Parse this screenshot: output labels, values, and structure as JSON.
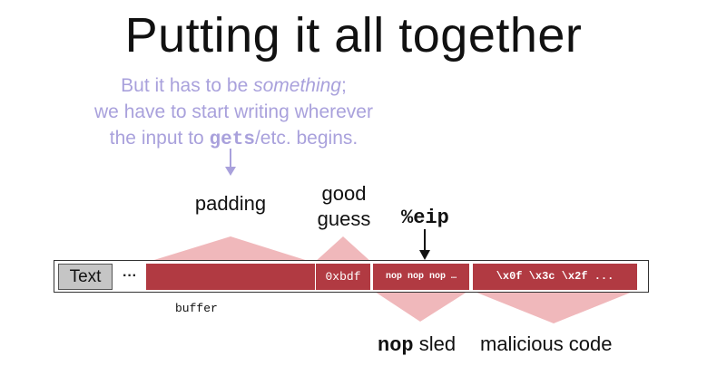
{
  "slide": {
    "title": "Putting it all together",
    "note_line1_prefix": "But it has to be ",
    "note_line1_em": "something",
    "note_line1_suffix": ";",
    "note_line2": "we have to start writing wherever",
    "note_line3_prefix": "the input to ",
    "note_line3_code": "gets",
    "note_line3_suffix": "/etc. begins.",
    "padding_label": "padding",
    "good_guess_line1": "good",
    "good_guess_line2": "guess",
    "eip_label": "%eip",
    "cells": {
      "text": "Text",
      "dots": "···",
      "guess": "0xbdf",
      "nop": "nop nop nop …",
      "code": "\\x0f \\x3c \\x2f ..."
    },
    "buffer_label": "buffer",
    "nop_sled_code": "nop",
    "nop_sled_rest": " sled",
    "malicious_label": "malicious code"
  },
  "colors": {
    "accent_red": "#b13a42",
    "pink_fan": "#f0b8bb",
    "note_purple": "#a9a1dc"
  }
}
